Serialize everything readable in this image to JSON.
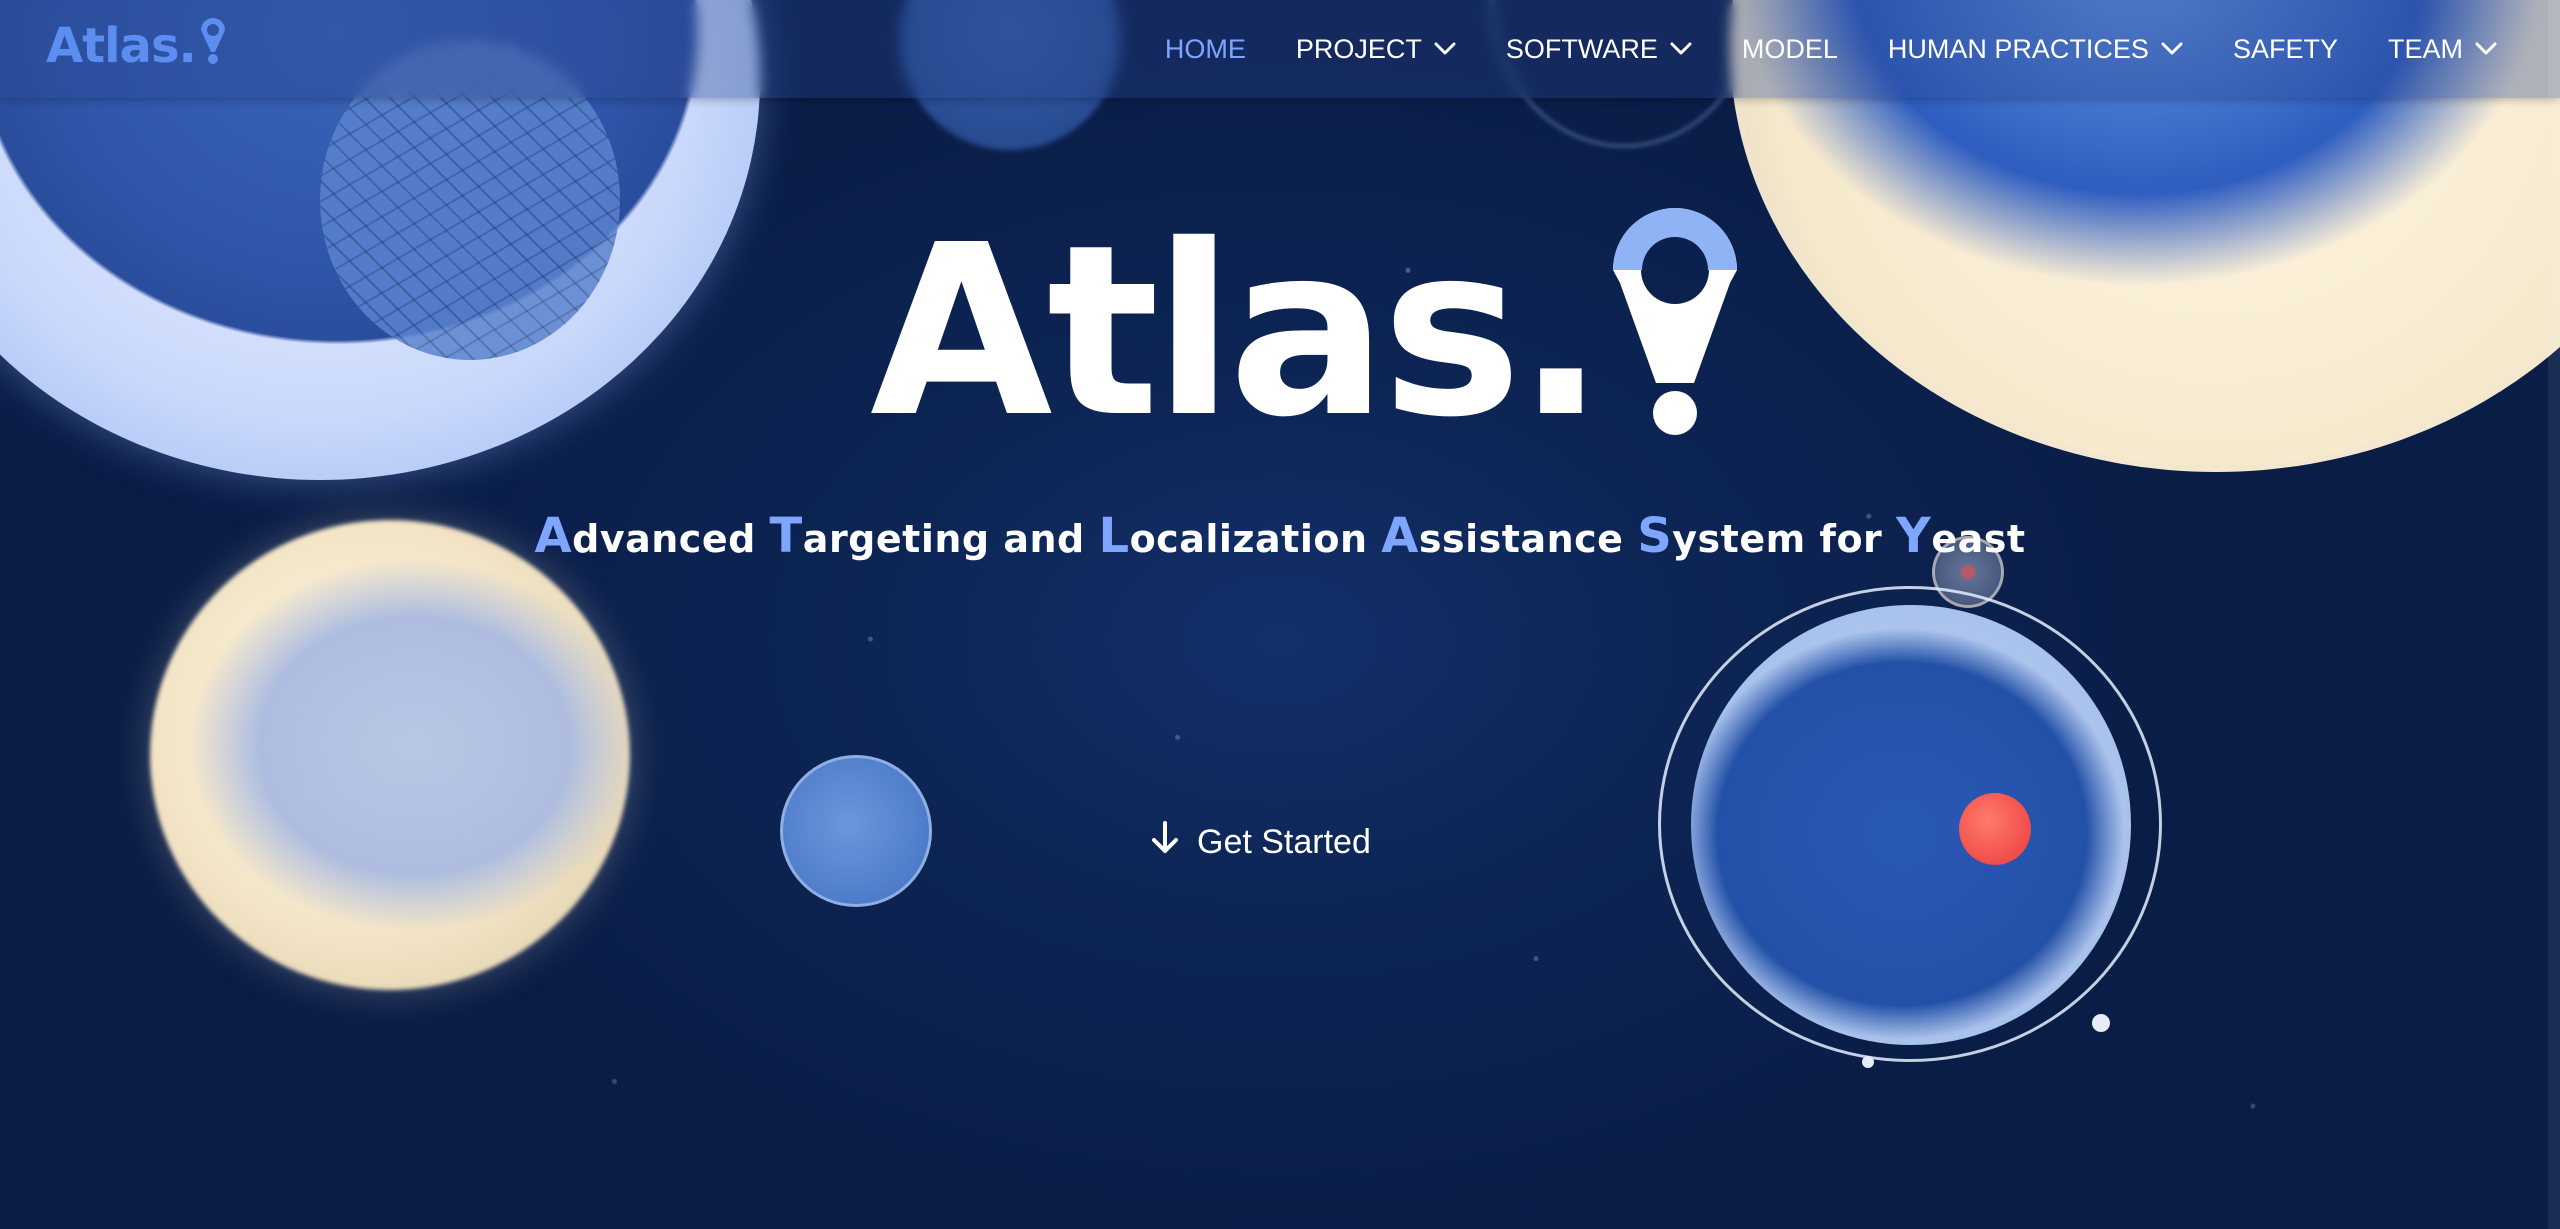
{
  "brand": {
    "name": "Atlas.",
    "icon": "location-pin-icon",
    "color": "#5b8ef0"
  },
  "nav": {
    "items": [
      {
        "label": "HOME",
        "active": true,
        "has_dropdown": false
      },
      {
        "label": "PROJECT",
        "active": false,
        "has_dropdown": true
      },
      {
        "label": "SOFTWARE",
        "active": false,
        "has_dropdown": true
      },
      {
        "label": "MODEL",
        "active": false,
        "has_dropdown": false
      },
      {
        "label": "HUMAN PRACTICES",
        "active": false,
        "has_dropdown": true
      },
      {
        "label": "SAFETY",
        "active": false,
        "has_dropdown": false
      },
      {
        "label": "TEAM",
        "active": false,
        "has_dropdown": true
      }
    ],
    "active_color": "#7fa6ff"
  },
  "hero": {
    "title": "Atlas.",
    "tagline": {
      "words": [
        {
          "cap": "A",
          "rest": "dvanced"
        },
        {
          "cap": "T",
          "rest": "argeting"
        },
        {
          "cap": "",
          "rest": "and"
        },
        {
          "cap": "L",
          "rest": "ocalization"
        },
        {
          "cap": "A",
          "rest": "ssistance"
        },
        {
          "cap": "S",
          "rest": "ystem"
        },
        {
          "cap": "",
          "rest": "for"
        },
        {
          "cap": "Y",
          "rest": "east"
        }
      ],
      "accent_color": "#7fa6ff"
    },
    "cta": {
      "label": "Get Started",
      "icon": "arrow-down-icon"
    }
  },
  "colors": {
    "background": "#0b1f48",
    "text": "#ffffff"
  }
}
